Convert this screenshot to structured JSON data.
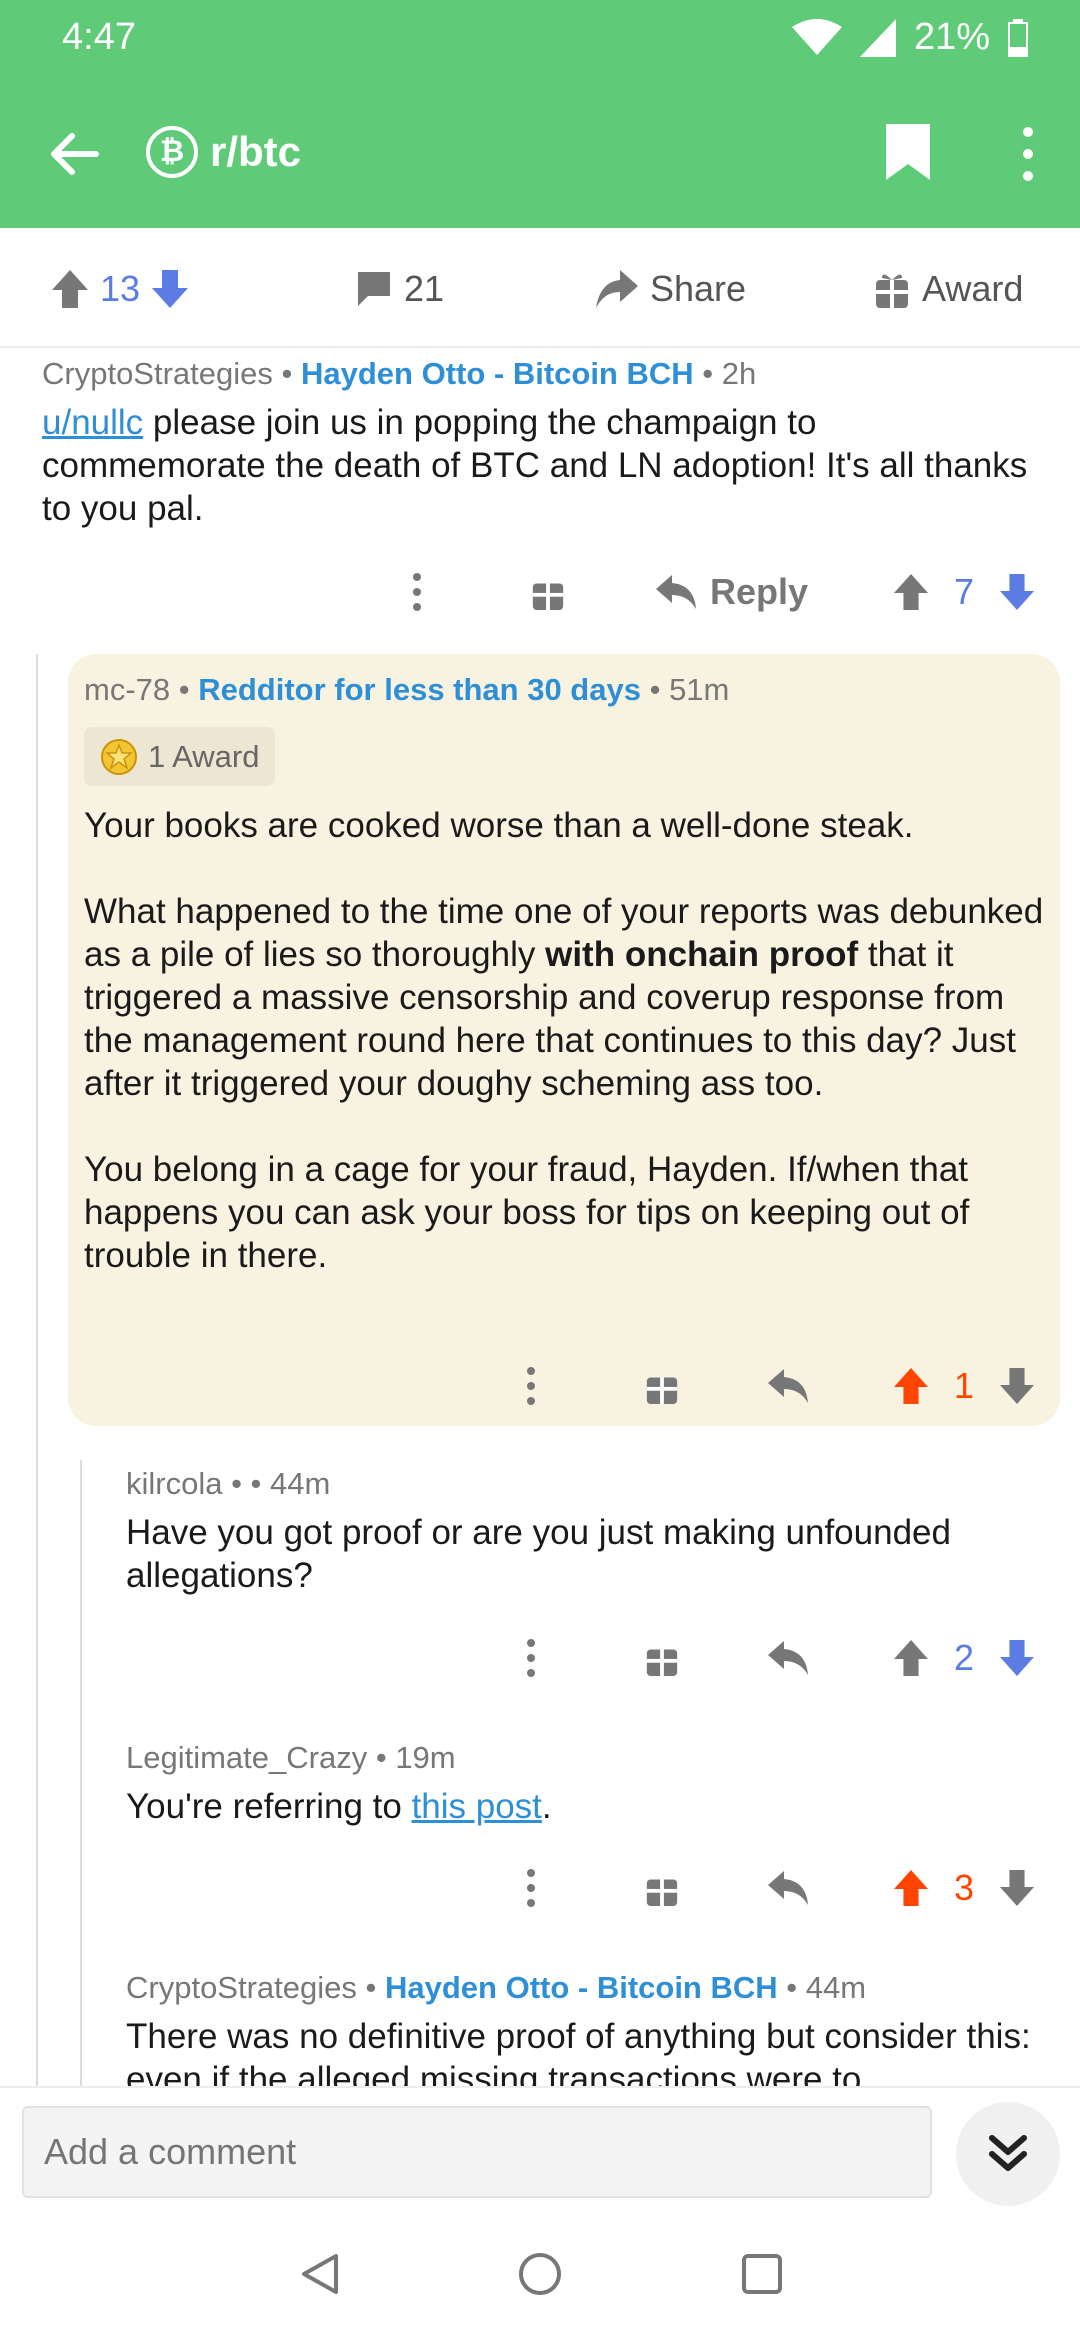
{
  "status": {
    "time": "4:47",
    "battery": "21%"
  },
  "toolbar": {
    "subreddit": "r/btc",
    "subreddit_icon_letter": "₿"
  },
  "actions": {
    "score": "13",
    "comments": "21",
    "share": "Share",
    "award": "Award"
  },
  "comments": [
    {
      "author": "CryptoStrategies",
      "flair": "Hayden Otto - Bitcoin BCH",
      "time": "2h",
      "link": "u/nullc",
      "body": " please join us in popping the champaign to commemorate the death of BTC and LN adoption! It's all thanks to you pal.",
      "reply": "Reply",
      "score": "7"
    },
    {
      "author": "mc-78",
      "flair": "Redditor for less than 30 days",
      "time": "51m",
      "awards": "1 Award",
      "p1": "Your books are cooked worse than a well-done steak.",
      "p2a": "What happened to the time one of your reports was debunked as a pile of lies so thoroughly ",
      "p2b": "with onchain proof",
      "p2c": " that it triggered a massive censorship and coverup response from the management round here that continues to this day? Just after it triggered your doughy scheming ass too.",
      "p3": "You belong in a cage for your fraud, Hayden. If/when that happens you can ask your boss for tips on keeping out of trouble in there.",
      "score": "1"
    },
    {
      "author": "kilrcola",
      "time": "44m",
      "body": "Have you got proof or are you just making unfounded allegations?",
      "score": "2"
    },
    {
      "author": "Legitimate_Crazy",
      "time": "19m",
      "body_pre": "You're referring to ",
      "link": "this post",
      "body_post": ".",
      "score": "3"
    },
    {
      "author": "CryptoStrategies",
      "flair": "Hayden Otto - Bitcoin BCH",
      "time": "44m",
      "body": "There was no definitive proof of anything but consider this: even if the alleged missing transactions were to"
    }
  ],
  "composer": {
    "placeholder": "Add a comment"
  },
  "colors": {
    "header": "#5fcb78",
    "upvote_active": "#ff4500",
    "blue": "#5b7de3",
    "flair": "#2f8fd6",
    "highlight_bg": "#f8f3e1"
  }
}
